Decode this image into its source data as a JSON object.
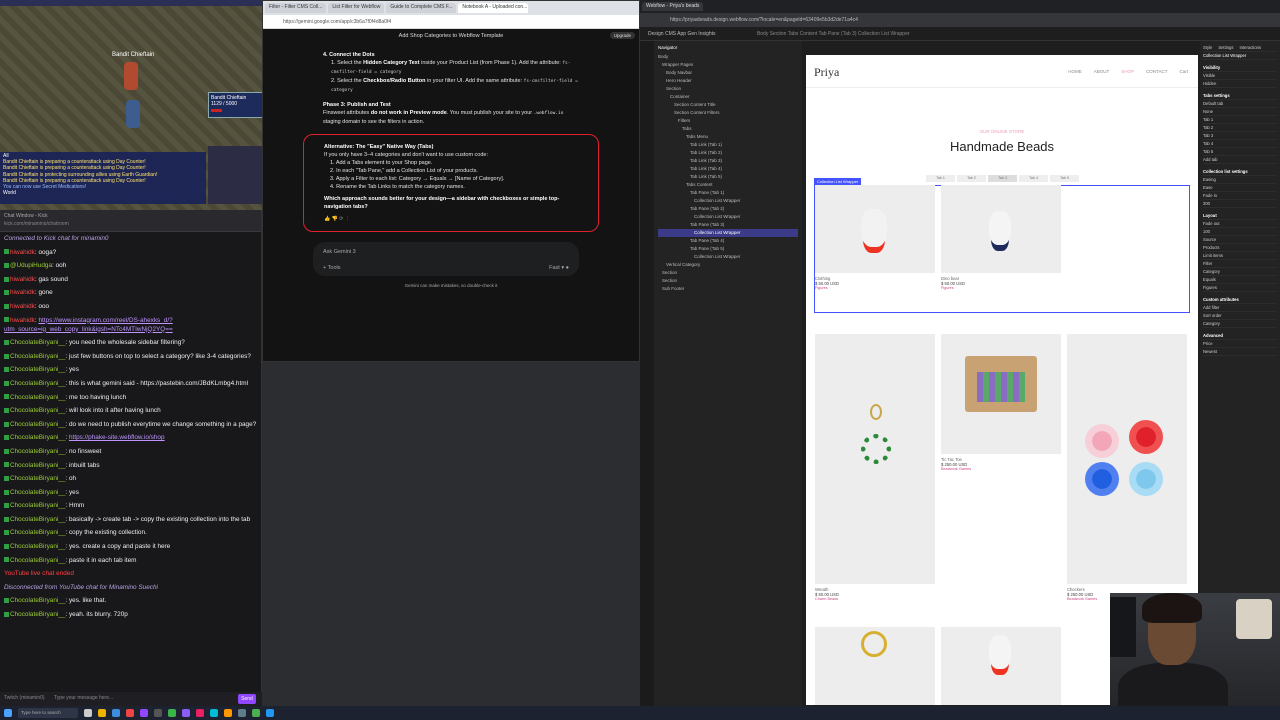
{
  "game": {
    "boss_name": "Bandit Chieftain",
    "hud_name": "Bandit Chieftain",
    "hud_hp": "1129 / 5000",
    "chat_lines": [
      "Bandit Chieftain is preparing a counterattack using Day Counter!",
      "Bandit Chieftain is preparing a counterattack using Day Counter!",
      "Bandit Chieftain is protecting surrounding allies using Earth Guardian!",
      "Bandit Chieftain is preparing a counterattack using Day Counter!",
      "You can now use Secret Medications!"
    ],
    "chat_tab_all": "All",
    "chat_tab_world": "World"
  },
  "chat": {
    "browser_title": "Chat Window - Kick",
    "url": "kick.com/minamino/chatroom",
    "connected": "Connected to Kick chat for minamin0",
    "messages": [
      {
        "user": "hiwahidk",
        "cls": "u1",
        "text": "ooga?"
      },
      {
        "user": "@UdupiHudga",
        "cls": "u2",
        "text": "ooh"
      },
      {
        "user": "hiwahidk",
        "cls": "u1",
        "text": "gas sound"
      },
      {
        "user": "hiwahidk",
        "cls": "u1",
        "text": "gone"
      },
      {
        "user": "hiwahidk",
        "cls": "u1",
        "text": "ooo"
      },
      {
        "user": "hiwahidk",
        "cls": "u1",
        "text": "https://www.instagram.com/reel/DS-ahexks_d/?utm_source=ig_web_copy_link&igsh=NTc4MTIwNjQ2YQ=="
      },
      {
        "user": "ChocolateBiryani__",
        "cls": "u2",
        "text": "you need the wholesale sidebar filtering?"
      },
      {
        "user": "ChocolateBiryani__",
        "cls": "u2",
        "text": "just few buttons on top to select a category? like 3-4 categories?"
      },
      {
        "user": "ChocolateBiryani__",
        "cls": "u2",
        "text": "yes"
      },
      {
        "user": "ChocolateBiryani__",
        "cls": "u2",
        "text": "this is what gemini said - https://pastebin.com/JBdKLmbg4.html"
      },
      {
        "user": "ChocolateBiryani__",
        "cls": "u2",
        "text": "me too having lunch"
      },
      {
        "user": "ChocolateBiryani__",
        "cls": "u2",
        "text": "will look into it after having lunch"
      },
      {
        "user": "ChocolateBiryani__",
        "cls": "u2",
        "text": "do we need to publish everytime we change something in a page?"
      },
      {
        "user": "ChocolateBiryani__",
        "cls": "u2",
        "text": "https://phake-site.webflow.io/shop"
      },
      {
        "user": "ChocolateBiryani__",
        "cls": "u2",
        "text": "no finsweet"
      },
      {
        "user": "ChocolateBiryani__",
        "cls": "u2",
        "text": "inbuilt tabs"
      },
      {
        "user": "ChocolateBiryani__",
        "cls": "u2",
        "text": "oh"
      },
      {
        "user": "ChocolateBiryani__",
        "cls": "u2",
        "text": "yes"
      },
      {
        "user": "ChocolateBiryani__",
        "cls": "u2",
        "text": "Hmm"
      },
      {
        "user": "ChocolateBiryani__",
        "cls": "u2",
        "text": "basically -> create tab -> copy the existing collection into the tab"
      },
      {
        "user": "ChocolateBiryani__",
        "cls": "u2",
        "text": "copy the existing collection."
      },
      {
        "user": "ChocolateBiryani__",
        "cls": "u2",
        "text": "yes. create a copy and paste it here"
      },
      {
        "user": "ChocolateBiryani__",
        "cls": "u2",
        "text": "paste it in each tab item"
      }
    ],
    "yt_ended": "YouTube live chat ended",
    "disconnected": "Disconnected from YouTube chat for Minamino Suechi",
    "messages2": [
      {
        "user": "ChocolateBiryani__",
        "cls": "u2",
        "text": "yes. like that."
      },
      {
        "user": "ChocolateBiryani__",
        "cls": "u2",
        "text": "yeah. its blurry. 720p"
      }
    ],
    "input_placeholder": "Type your message here...",
    "input_prefix": "Twitch (minamin0)",
    "send": "Send"
  },
  "gemini": {
    "tabs": [
      "Filter - Filter CMS Coll...",
      "List Filter for Webflow",
      "Guide to Complete CMS F...",
      "Notebook A - Uploaded con..."
    ],
    "url": "https://gemini.google.com/app/c3b6a7f0f4d8a0f4",
    "header": "Add Shop Categories to Webflow Template",
    "upgrade": "Upgrade",
    "step4_title": "4. Connect the Dots",
    "step4_1a": "Select the",
    "step4_1b": "Hidden Category Text",
    "step4_1c": "inside your Product List (from Phase 1). Add the attribute:",
    "step4_1d": "fs-cmsfilter-field = category",
    "step4_2a": "Select the",
    "step4_2b": "Checkbox/Radio Button",
    "step4_2c": "in your filter UI. Add the same attribute:",
    "step4_2d": "fs-cmsfilter-field = category",
    "phase3_title": "Phase 3: Publish and Test",
    "phase3_a": "Finsweet attributes",
    "phase3_b": "do not work in Preview mode",
    "phase3_c": ". You must publish your site to your",
    "phase3_d": ".webflow.io",
    "phase3_e": "staging domain to see the filters in action.",
    "alt_title": "Alternative: The \"Easy\" Native Way (Tabs)",
    "alt_intro": "If you only have 3–4 categories and don't want to use custom code:",
    "alt_1": "Add a Tabs element to your Shop page.",
    "alt_2": "In each \"Tab Pane,\" add a Collection List of your products.",
    "alt_3": "Apply a Filter to each list: Category → Equals → [Name of Category].",
    "alt_4": "Rename the Tab Links to match the category names.",
    "alt_q": "Which approach sounds better for your design—a sidebar with checkboxes or simple top-navigation tabs?",
    "ask_placeholder": "Ask Gemini 3",
    "tools": "Tools",
    "mode": "Fast",
    "footer": "Gemini can make mistakes, so double-check it"
  },
  "webflow": {
    "tabs": [
      "Webflow - Priya's beads"
    ],
    "url": "https://priyasbeads.design.webflow.com/?locale=en&pageId=63409e5b3d2de71a4c4",
    "toolbar": "Design  CMS  App Gen  Insights",
    "breadcrumb": "Body  Section  Tabs Content  Tab Pane (Tab 3)  Collection List Wrapper",
    "navigator_title": "Navigator",
    "nav_items": [
      "Body",
      "Wrapper Pages",
      "Body Navbar",
      "Hero Header",
      "Section",
      "Container",
      "Section Content Title",
      "Section Content Filters",
      "Filters",
      "Tabs",
      "Tabs Menu",
      "Tab Link (Tab 1)",
      "Tab Link (Tab 2)",
      "Tab Link (Tab 3)",
      "Tab Link (Tab 4)",
      "Tab Link (Tab 5)",
      "Tabs Content",
      "Tab Pane (Tab 1)",
      "Collection List Wrapper",
      "Tab Pane (Tab 2)",
      "Collection List Wrapper",
      "Tab Pane (Tab 3)",
      "Collection List Wrapper",
      "Tab Pane (Tab 4)",
      "Tab Pane (Tab 5)",
      "Collection List Wrapper",
      "Vertical Category",
      "Section",
      "Section",
      "Sub Footer"
    ],
    "nav_selected_index": 22,
    "site": {
      "logo": "Priya",
      "nav": [
        "HOME",
        "ABOUT",
        "SHOP",
        "CONTACT",
        "Cart"
      ],
      "active_nav": "SHOP",
      "eyebrow": "OUR ONLINE STORE",
      "heading": "Handmade Beads",
      "tabs": [
        "Tab 1",
        "Tab 2",
        "Tab 3",
        "Tab 4",
        "Tab 5"
      ],
      "current_tab": "Tab 3",
      "selection_label": "Collection List Wrapper",
      "products_top": [
        {
          "title": "Clothing",
          "price": "$ 50.00 USD",
          "cat": "Figures"
        },
        {
          "title": "Dino bear",
          "price": "$ 50.00 USD",
          "cat": "Figures"
        }
      ],
      "products_mid": [
        {
          "title": "Wreath",
          "price": "$ 50.00 USD",
          "cat": "Charm Beads"
        },
        {
          "title": "Tic Tac Toe",
          "price": "$ 250.00 USD",
          "cat": "Beadwork Games"
        },
        {
          "title": "Checkers",
          "price": "$ 250.00 USD",
          "cat": "Beadwork Games"
        }
      ]
    },
    "right_panel": {
      "tabs": [
        "Style",
        "Settings",
        "Interactions"
      ],
      "element": "Collection List Wrapper",
      "sections": [
        "Visibility",
        "Tabs settings",
        "Collection list settings",
        "Layout",
        "Custom attributes",
        "Advanced"
      ],
      "rows": [
        "Visible",
        "Hidden",
        "Default tab",
        "None",
        "Tab 1",
        "Tab 2",
        "Tab 3",
        "Tab 4",
        "Tab 5",
        "Add tab",
        "Easing",
        "Ease",
        "Fade in",
        "300",
        "Fade out",
        "100",
        "Source",
        "Products",
        "Limit items",
        "Filter",
        "Category",
        "Equals",
        "Figures",
        "Add filter",
        "Sort order",
        "Category",
        "Price",
        "Newest",
        "Oldest",
        "Custom attributes",
        "Advanced"
      ]
    }
  },
  "taskbar": {
    "search": "Type here to search"
  }
}
